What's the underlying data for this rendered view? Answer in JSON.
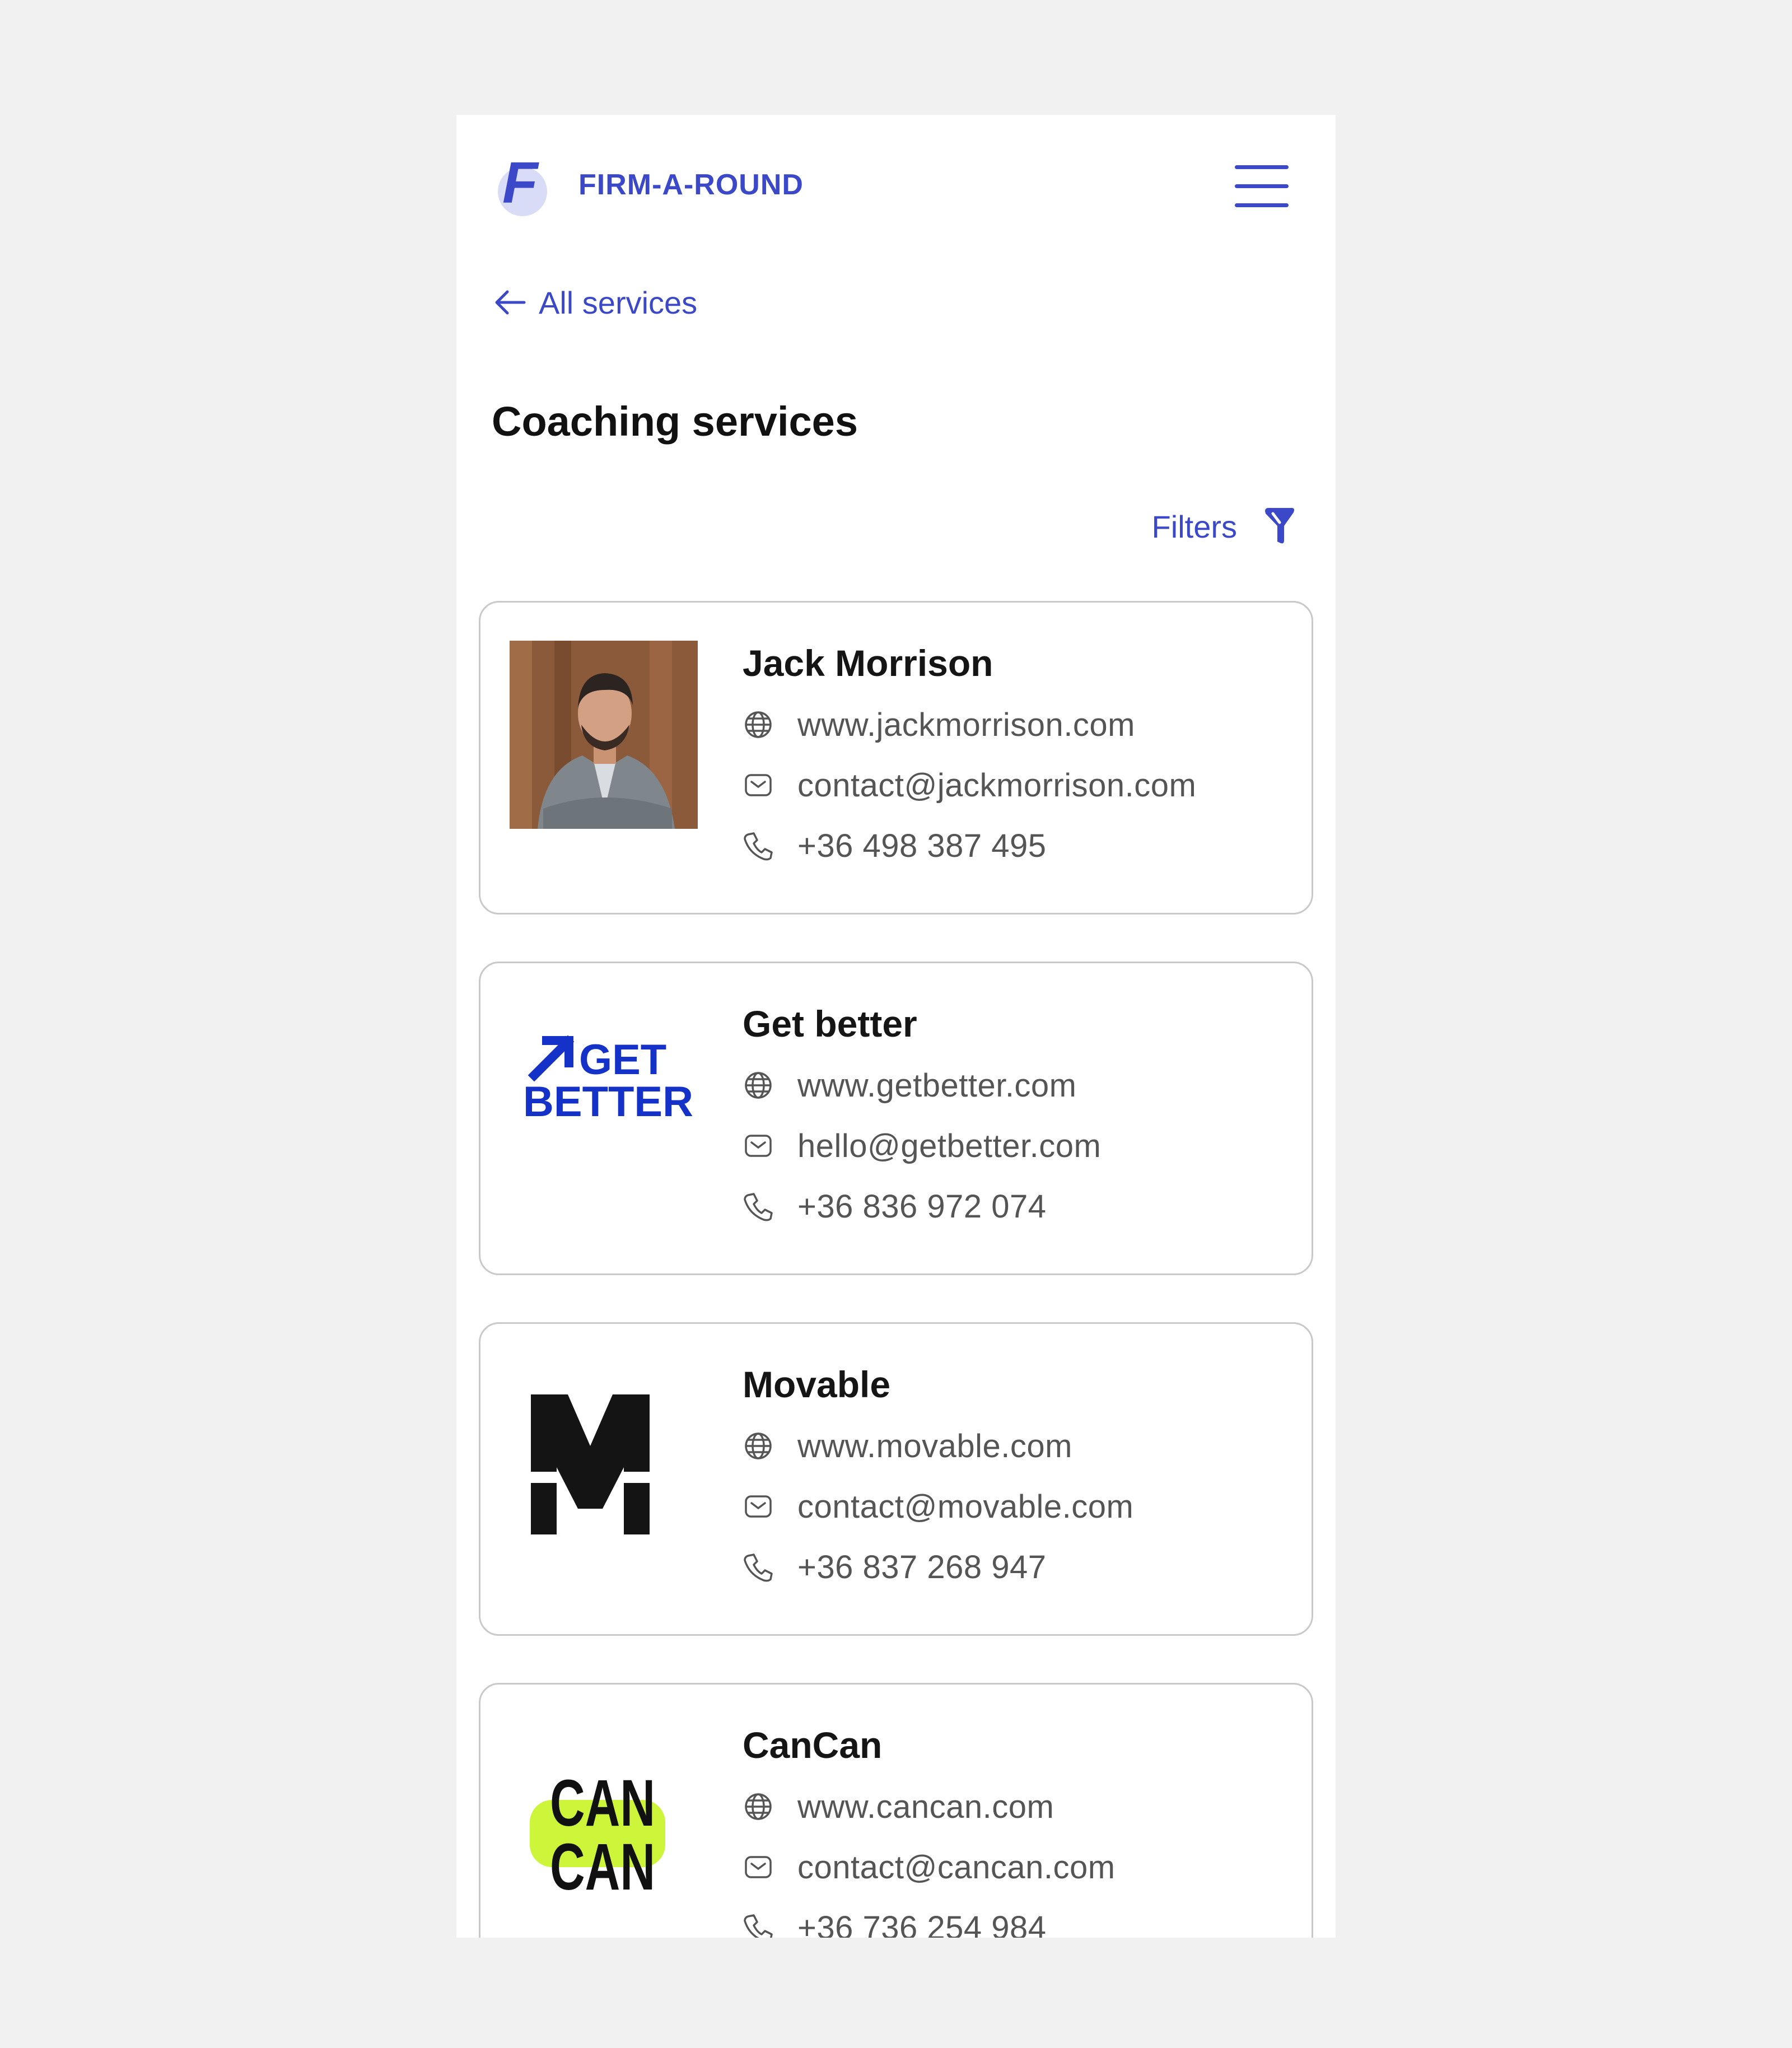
{
  "brand": {
    "name": "FIRM-A-ROUND",
    "letter": "F"
  },
  "nav": {
    "back_label": "All services"
  },
  "page": {
    "title": "Coaching services",
    "filters_label": "Filters"
  },
  "colors": {
    "accent": "#3b49c8",
    "getbetter_blue": "#1432c8",
    "cancan_lime": "#cdf53a"
  },
  "listings": [
    {
      "name": "Jack Morrison",
      "logo": "photo-jack-morrison",
      "website": "www.jackmorrison.com",
      "email": "contact@jackmorrison.com",
      "phone": "+36 498 387 495"
    },
    {
      "name": "Get better",
      "logo": "logo-get-better",
      "logo_line1": "GET",
      "logo_line2": "BETTER",
      "website": "www.getbetter.com",
      "email": "hello@getbetter.com",
      "phone": "+36 836 972 074"
    },
    {
      "name": "Movable",
      "logo": "logo-movable",
      "logo_text": "M",
      "website": "www.movable.com",
      "email": "contact@movable.com",
      "phone": "+36 837 268 947"
    },
    {
      "name": "CanCan",
      "logo": "logo-cancan",
      "logo_line1": "CAN",
      "logo_line2": "CAN",
      "website": "www.cancan.com",
      "email": "contact@cancan.com",
      "phone": "+36 736 254 984"
    }
  ]
}
